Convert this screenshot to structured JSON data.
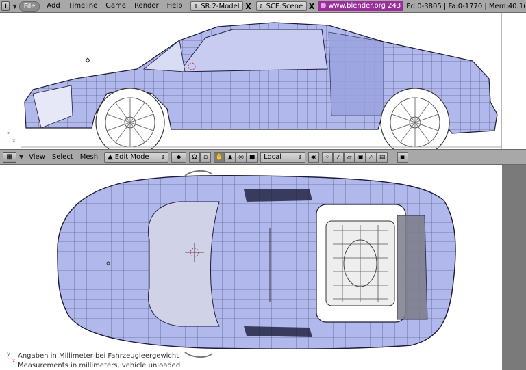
{
  "header": {
    "menus": [
      "File",
      "Add",
      "Timeline",
      "Game",
      "Render",
      "Help"
    ],
    "screen_field": "SR:2-Model",
    "scene_field": "SCE:Scene",
    "close_glyph": "X",
    "url": "www.blender.org 243",
    "stats": "Ed:0-3805 | Fa:0-1770 | Mem:40.1("
  },
  "view_header": {
    "menus": [
      "View",
      "Select",
      "Mesh"
    ],
    "mode": "Edit Mode",
    "orientation": "Local"
  },
  "captions": {
    "de": "Angaben in Millimeter bei Fahrzeugleergewicht",
    "en": "Measurements in millimeters, vehicle unloaded"
  },
  "axes": {
    "z": "z",
    "x": "x",
    "y": "y"
  },
  "colors": {
    "mesh_fill": "#b0b8ec",
    "wire": "#1c1c3a",
    "header_bg": "#a8a8a8",
    "url_bg": "#9a2d9a"
  }
}
